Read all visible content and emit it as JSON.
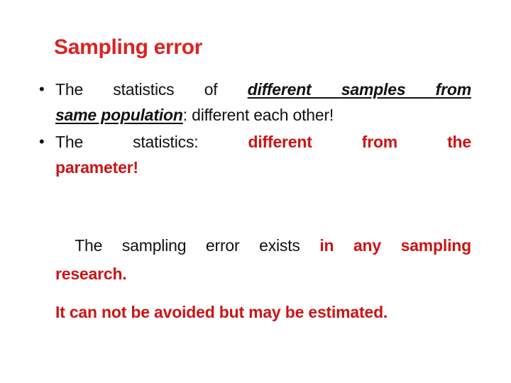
{
  "slide": {
    "title": "Sampling error",
    "title_color": "#DD2222",
    "accent_red": "#CC1414",
    "text_black": "#111111",
    "background": "#FFFFFF",
    "bullet_glyph": "•",
    "bullets": [
      {
        "id": "bullet-1",
        "line1_prefix": "The  statistics  of ",
        "emph_1": "different ",
        "emph_2": "samples ",
        "emph_3": "from",
        "line2_emph": "same population",
        "line2_rest": ":  different each other!"
      },
      {
        "id": "bullet-2",
        "line1_black": "The    statistics:",
        "line1_red": "different    from    the",
        "line2_red": "parameter!"
      }
    ],
    "note": {
      "line1_black": " The sampling error exists ",
      "line1_red": "in any sampling",
      "line2_red": "research.",
      "line3_red": "It can not be avoided but may be estimated."
    }
  }
}
